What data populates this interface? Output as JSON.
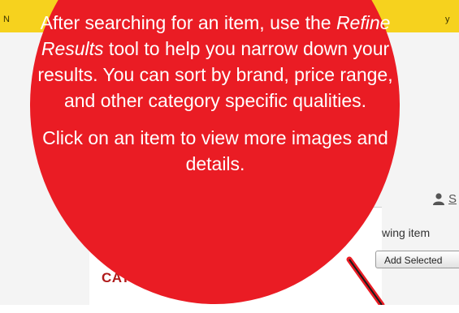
{
  "top_strip": {
    "left_letter": "N",
    "right_letter": "y",
    "color": "#f6d21e"
  },
  "page": {
    "categories_heading": "CATEG",
    "showing_items": "wing item",
    "add_selected_button": "Add Selected",
    "user_link": "S"
  },
  "callout": {
    "color": "#ea1c24",
    "paragraph1_before": "After searching for an item, use the ",
    "paragraph1_emphasis": "Refine Results",
    "paragraph1_after": " tool to help you narrow down your results. You can sort by brand, price range, and other category specific qualities.",
    "paragraph2": "Click on an item to view more images and details."
  },
  "icons": [
    "user-icon",
    "arrow-pointer"
  ]
}
